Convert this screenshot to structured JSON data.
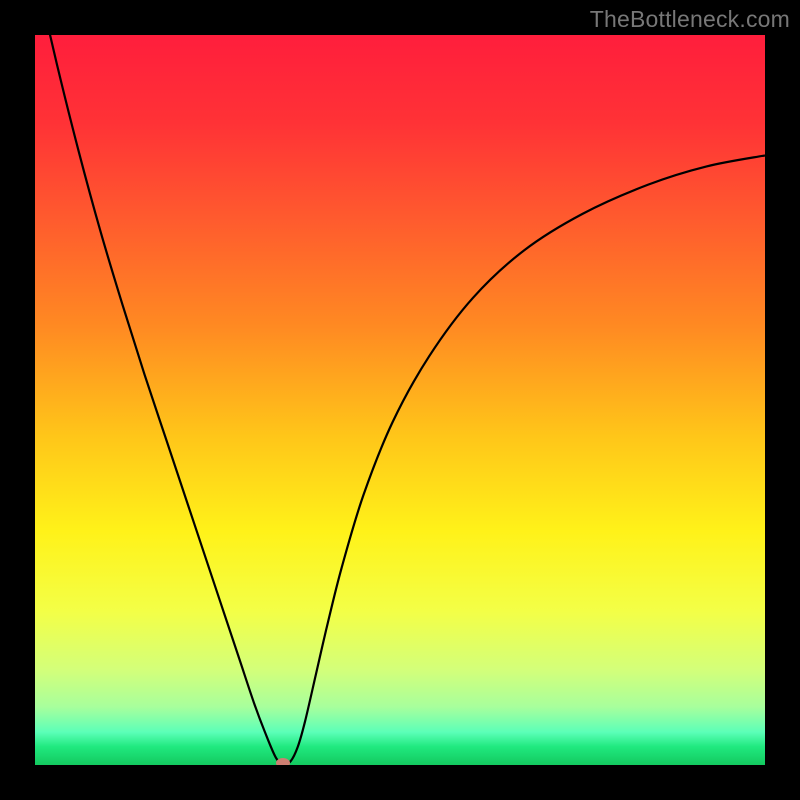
{
  "watermark": {
    "text": "TheBottleneck.com"
  },
  "chart_data": {
    "type": "line",
    "title": "",
    "xlabel": "",
    "ylabel": "",
    "xlim": [
      0,
      100
    ],
    "ylim": [
      0,
      100
    ],
    "gradient_stops": [
      {
        "offset": 0.0,
        "color": "#ff1e3c"
      },
      {
        "offset": 0.12,
        "color": "#ff3236"
      },
      {
        "offset": 0.25,
        "color": "#ff5a2e"
      },
      {
        "offset": 0.4,
        "color": "#ff8a22"
      },
      {
        "offset": 0.55,
        "color": "#ffc619"
      },
      {
        "offset": 0.68,
        "color": "#fff219"
      },
      {
        "offset": 0.79,
        "color": "#f3ff47"
      },
      {
        "offset": 0.87,
        "color": "#d3ff7a"
      },
      {
        "offset": 0.92,
        "color": "#a8ff9c"
      },
      {
        "offset": 0.955,
        "color": "#5cffb8"
      },
      {
        "offset": 0.975,
        "color": "#20e97f"
      },
      {
        "offset": 1.0,
        "color": "#13c95f"
      }
    ],
    "series": [
      {
        "name": "bottleneck-curve",
        "x": [
          0.0,
          3.0,
          6.0,
          9.0,
          12.0,
          15.0,
          18.0,
          21.0,
          24.0,
          26.0,
          28.0,
          30.0,
          31.5,
          33.0,
          34.0,
          35.0,
          36.0,
          37.0,
          38.5,
          40.0,
          42.0,
          45.0,
          49.0,
          54.0,
          60.0,
          67.0,
          75.0,
          84.0,
          92.0,
          100.0
        ],
        "y": [
          109.0,
          96.0,
          84.0,
          73.0,
          63.0,
          53.5,
          44.5,
          35.5,
          26.5,
          20.5,
          14.5,
          8.5,
          4.5,
          1.0,
          0.2,
          0.5,
          2.5,
          6.0,
          12.5,
          19.0,
          27.0,
          37.0,
          47.0,
          56.0,
          64.0,
          70.5,
          75.5,
          79.5,
          82.0,
          83.5
        ]
      }
    ],
    "marker": {
      "x": 34.0,
      "y": 0.3,
      "color": "#cd7f72"
    }
  }
}
